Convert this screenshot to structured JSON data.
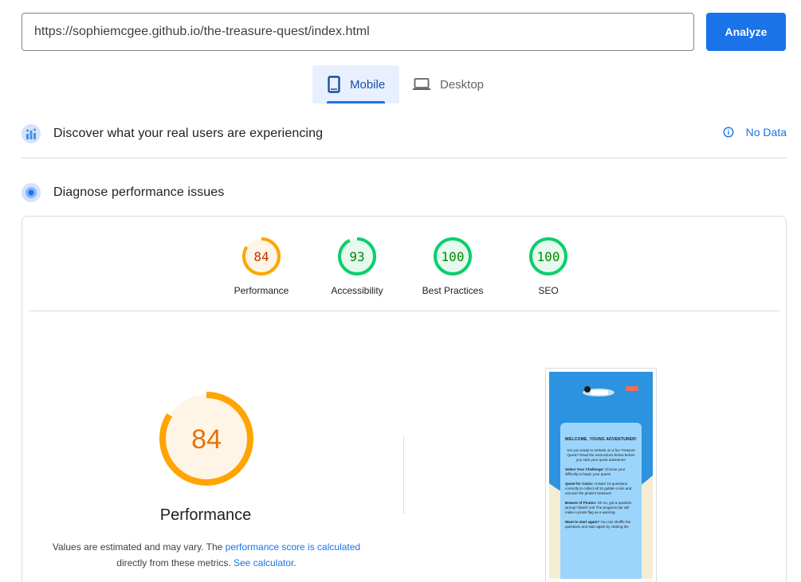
{
  "search": {
    "url_value": "https://sophiemcgee.github.io/the-treasure-quest/index.html",
    "analyze_label": "Analyze"
  },
  "tabs": {
    "mobile": "Mobile",
    "desktop": "Desktop"
  },
  "crux": {
    "title": "Discover what your real users are experiencing",
    "nodata": "No Data"
  },
  "diagnose": {
    "title": "Diagnose performance issues"
  },
  "scores": [
    {
      "label": "Performance",
      "value": "84",
      "score": 0.84,
      "color": "#ffa400"
    },
    {
      "label": "Accessibility",
      "value": "93",
      "score": 0.93,
      "color": "#0cce6b"
    },
    {
      "label": "Best Practices",
      "value": "100",
      "score": 1.0,
      "color": "#0cce6b"
    },
    {
      "label": "SEO",
      "value": "100",
      "score": 1.0,
      "color": "#0cce6b"
    }
  ],
  "performance": {
    "value": "84",
    "score": 0.84,
    "title": "Performance",
    "desc_1": "Values are estimated and may vary. The ",
    "link_1": "performance score is calculated",
    "desc_2": " directly from these metrics. ",
    "link_2": "See calculator",
    "desc_3": "."
  },
  "screenshot": {
    "heading": "WELCOME, YOUNG ADVENTURER!",
    "intro": "Are you ready to embark on a fun Treasure Quest? Read the instructions below before you start your quest adventure!",
    "s1_title": "Select Your Challenge:",
    "s1_text": "Choose your difficulty to begin your quest!",
    "s2_title": "Quest for Coins:",
    "s2_text": "Answer 10 questions correctly to collect all 10 golden coins and uncover the pirate's treasure!",
    "s3_title": "Beware of Pirates:",
    "s3_text": "Oh no, got a question wrong? Watch out! The progress bar will make a pirate flag as a warning.",
    "s4_title": "Want to start again?",
    "s4_text": "You can shuffle the questions and start again by clicking the"
  },
  "colors": {
    "accent": "#1a73e8",
    "average": "#ffa400",
    "pass": "#0cce6b"
  }
}
